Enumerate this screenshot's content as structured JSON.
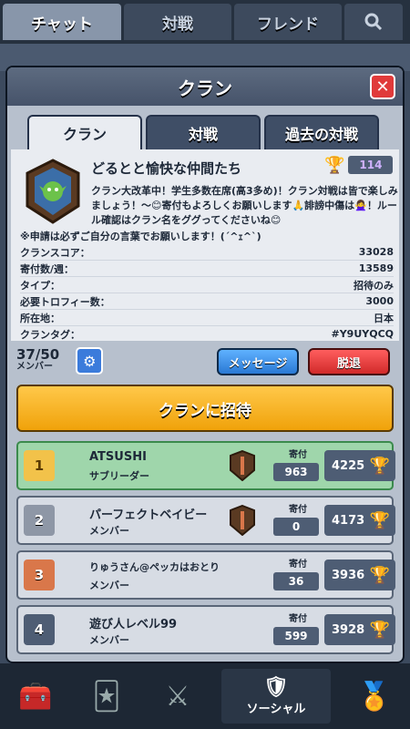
{
  "top_tabs": [
    "チャット",
    "対戦",
    "フレンド"
  ],
  "modal": {
    "title": "クラン",
    "close_icon": "close-icon",
    "tabs": [
      "クラン",
      "対戦",
      "過去の対戦"
    ]
  },
  "clan": {
    "name": "どるとと愉快な仲間たち",
    "trophies": "114",
    "description": "クラン大改革中！学生多数在席(高3多め)！クラン対戦は皆で楽しみましょう！〜😊寄付もよろしくお願いします🙏誹謗中傷は🙅‍♀️！ルール確認はクラン名をググってくださいね😊",
    "description2": "※申請は必ずご自分の言葉でお願いします！(´^ｪ^`)",
    "stats": [
      {
        "label": "クランスコア：",
        "value": "33028"
      },
      {
        "label": "寄付数/週：",
        "value": "13589"
      },
      {
        "label": "タイプ：",
        "value": "招待のみ"
      },
      {
        "label": "必要トロフィー数：",
        "value": "3000"
      },
      {
        "label": "所在地：",
        "value": "日本"
      },
      {
        "label": "クランタグ：",
        "value": "#Y9UYQCQ"
      }
    ]
  },
  "members_count": "37/50",
  "members_label": "メンバー",
  "buttons": {
    "message": "メッセージ",
    "leave": "脱退",
    "invite": "クランに招待"
  },
  "donation_label": "寄付",
  "members": [
    {
      "rank": "1",
      "name": "ATSUSHI",
      "role": "サブリーダー",
      "donations": "963",
      "trophies": "4225"
    },
    {
      "rank": "2",
      "name": "パーフェクトベイビー",
      "role": "メンバー",
      "donations": "0",
      "trophies": "4173"
    },
    {
      "rank": "3",
      "name": "りゅうさん@ペッカはおとり",
      "role": "メンバー",
      "donations": "36",
      "trophies": "3936"
    },
    {
      "rank": "4",
      "name": "遊び人レベル99",
      "role": "メンバー",
      "donations": "599",
      "trophies": "3928"
    }
  ],
  "bottom_nav_label": "ソーシャル",
  "colors": {
    "rank1": "#f2c24a",
    "rank2": "#8e97a6",
    "rank3": "#d9774a",
    "rank4": "#4e5d74"
  }
}
